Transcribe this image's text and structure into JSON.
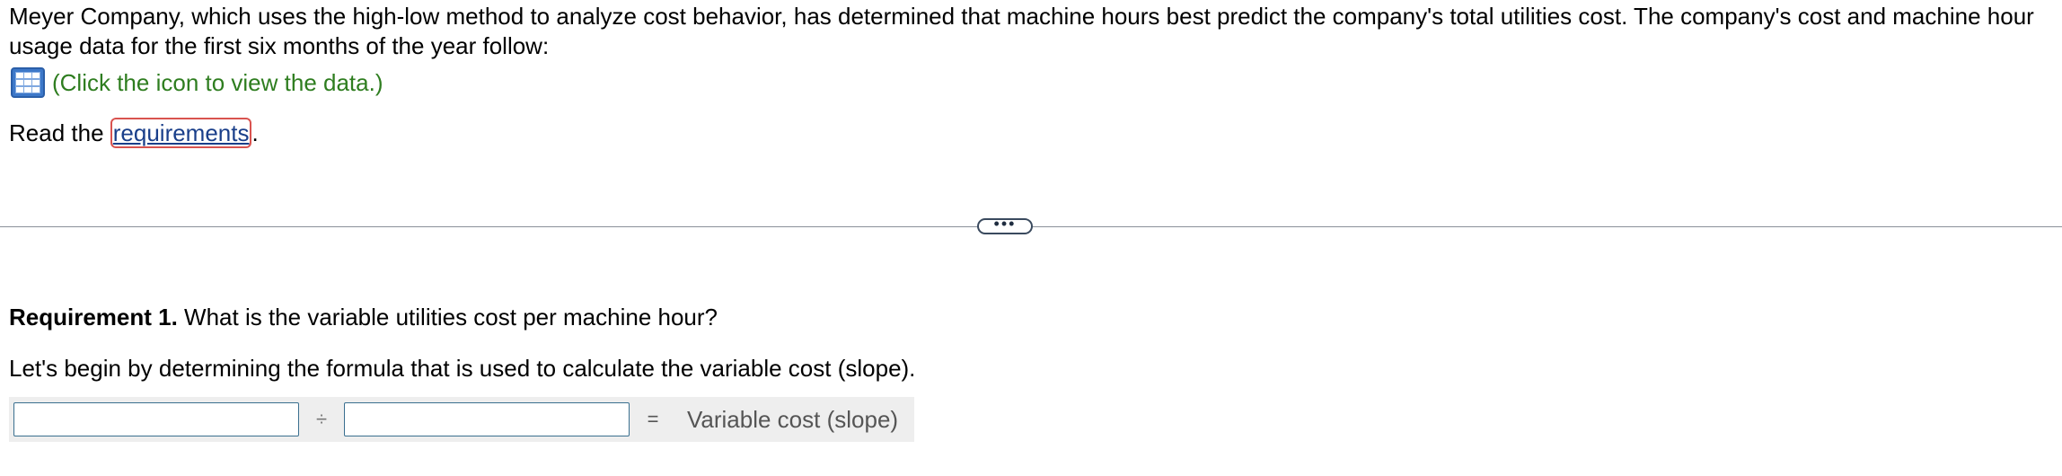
{
  "intro": {
    "text": "Meyer Company, which uses the high-low method to analyze cost behavior, has determined that machine hours best predict the company's total utilities cost. The company's cost and machine hour usage data for the first six months of the year follow:"
  },
  "data_link": {
    "icon": "table-grid-icon",
    "text": "(Click the icon to view the data.)",
    "color": "#2e7d1f"
  },
  "read_line": {
    "prefix": "Read the ",
    "link_text": "requirements",
    "suffix": "."
  },
  "divider": {
    "handle_text": "•••"
  },
  "requirement": {
    "label": "Requirement 1.",
    "question": " What is the variable utilities cost per machine hour?"
  },
  "formula": {
    "intro": "Let's begin by determining the formula that is used to calculate the variable cost (slope).",
    "input1_value": "",
    "operator": "÷",
    "input2_value": "",
    "equals": "=",
    "result_label": "Variable cost (slope)"
  }
}
